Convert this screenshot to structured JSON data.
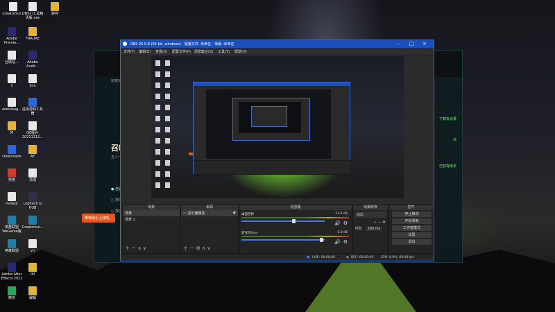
{
  "desktop": {
    "icons": [
      {
        "label": "CreatorSui...",
        "color": "#e8e8e8"
      },
      {
        "label": "OBS小工具箱\n清版.exe",
        "color": "#e8e8e8"
      },
      {
        "label": "转存",
        "color": "#e2b43a"
      },
      {
        "label": "Adobe\nPremie...",
        "color": "#2a2870"
      },
      {
        "label": "FRAUAE",
        "color": "#e2b43a"
      },
      {
        "label": "回收站...",
        "color": "#e8e8e8"
      },
      {
        "label": "Adobe\nAudit...",
        "color": "#2a2870"
      },
      {
        "label": "1",
        "color": "#e8e8e8"
      },
      {
        "label": "jinx",
        "color": "#e8e8e8"
      },
      {
        "label": "wieisleag...",
        "color": "#e8e8e8"
      },
      {
        "label": "虚拟游戏工具\n器",
        "color": "#2b67d8"
      },
      {
        "label": "M",
        "color": "#e2b43a"
      },
      {
        "label": "QQ图片\n20211112...",
        "color": "#e8e8e8"
      },
      {
        "label": "Downloads",
        "color": "#2b67d8"
      },
      {
        "label": "AE",
        "color": "#e2b43a"
      },
      {
        "label": "常用",
        "color": "#d23a2a"
      },
      {
        "label": "清理",
        "color": "#e8e8e8"
      },
      {
        "label": "msi&bt",
        "color": "#e8e8e8"
      },
      {
        "label": "Logitech G\nHUB",
        "color": "#30304a"
      },
      {
        "label": "英雄联盟\nWeGame版",
        "color": "#1f7da6"
      },
      {
        "label": "Creatorsui...",
        "color": "#1f7da6"
      },
      {
        "label": "英雄联盟",
        "color": "#1f7da6"
      },
      {
        "label": "vn",
        "color": "#e8e8e8"
      },
      {
        "label": "Adobe After\nEffects 2022",
        "color": "#2a2870"
      },
      {
        "label": "00",
        "color": "#e2b43a"
      },
      {
        "label": "微信",
        "color": "#2aa65a"
      },
      {
        "label": "编辑",
        "color": "#e2b43a"
      }
    ]
  },
  "bg_app": {
    "subtitle": "玩家对战",
    "title": "召唤",
    "desc1": "五人一队，",
    "desc2": "手并肩...",
    "opt1": "● 自选模",
    "opt2": "○ 排位模",
    "opt3": "○ 排位模",
    "right1": "下载有记录",
    "right2": "点",
    "right3": "已获得成长"
  },
  "tooltip": "推荐助手上线啦。",
  "obs": {
    "title": "OBS 25.0.8 (64-bit, windows) - 配置文件: 未命名 - 场景: 未命名",
    "menu": [
      "文件(F)",
      "编辑(E)",
      "查看(V)",
      "配置文件(P)",
      "场景集合(S)",
      "工具(T)",
      "帮助(H)"
    ],
    "docks": {
      "scenes": {
        "header": "场景",
        "items": [
          "场景",
          "场景 2"
        ]
      },
      "sources": {
        "header": "来源",
        "items": [
          "显示器捕获"
        ]
      },
      "mixer": {
        "header": "混音器",
        "channels": [
          {
            "name": "桌面音频",
            "db": "-14.6 dB"
          },
          {
            "name": "麦克风/Aux",
            "db": "0.0 dB"
          }
        ]
      },
      "transitions": {
        "header": "场景转换",
        "type": "淡出",
        "duration_label": "时长",
        "duration": "300 ms"
      },
      "controls": {
        "header": "控件",
        "buttons": [
          "停止推流",
          "开始录制",
          "工作室模式",
          "设置",
          "退出"
        ]
      }
    },
    "status": {
      "live": "LIVE: 00:00:00",
      "rec": "REC: 00:00:00",
      "cpu": "CPU: 0.9%, 60.00 fps"
    }
  }
}
